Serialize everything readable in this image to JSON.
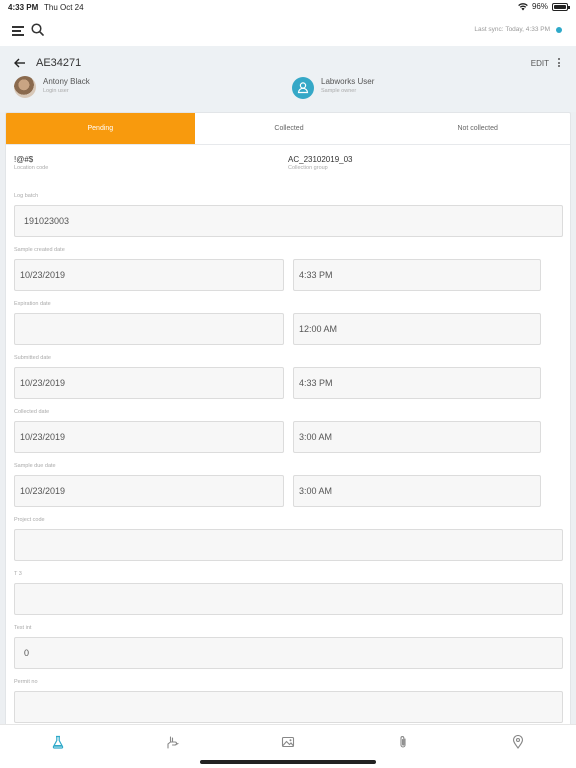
{
  "status_bar": {
    "time": "4:33 PM",
    "date": "Thu Oct 24",
    "battery": "96%"
  },
  "app_bar": {
    "sync_label": "Last sync:",
    "sync_time": "Today, 4:33 PM",
    "sync_dot_color": "#2ea9c9"
  },
  "header": {
    "record_id": "AE34271",
    "edit_label": "EDIT",
    "login_user": {
      "name": "Antony Black",
      "role": "Login user"
    },
    "sample_owner": {
      "name": "Labworks User",
      "role": "Sample owner"
    }
  },
  "tabs": [
    {
      "label": "Pending",
      "active": true
    },
    {
      "label": "Collected",
      "active": false
    },
    {
      "label": "Not collected",
      "active": false
    }
  ],
  "accent_color": "#f89a0d",
  "location": {
    "value": "!@#$",
    "label": "Location code"
  },
  "collection_group": {
    "value": "AC_23102019_03",
    "label": "Collection group"
  },
  "form": {
    "log_batch": {
      "label": "Log batch",
      "value": "191023003"
    },
    "sample_created": {
      "label": "Sample created date",
      "date": "10/23/2019",
      "time": "4:33 PM"
    },
    "expiration": {
      "label": "Expiration date",
      "date": "",
      "time": "12:00 AM"
    },
    "submitted": {
      "label": "Submitted date",
      "date": "10/23/2019",
      "time": "4:33 PM"
    },
    "collected": {
      "label": "Collected date",
      "date": "10/23/2019",
      "time": "3:00 AM"
    },
    "sample_due": {
      "label": "Sample due date",
      "date": "10/23/2019",
      "time": "3:00 AM"
    },
    "project_code": {
      "label": "Project code",
      "value": ""
    },
    "t3": {
      "label": "T 3",
      "value": ""
    },
    "test_int": {
      "label": "Test int",
      "value": "0"
    },
    "permit_no": {
      "label": "Permit no",
      "value": ""
    }
  },
  "bottom_nav": [
    {
      "icon": "flask-icon",
      "active": true
    },
    {
      "icon": "sample-hand-icon",
      "active": false
    },
    {
      "icon": "image-icon",
      "active": false
    },
    {
      "icon": "attachment-icon",
      "active": false
    },
    {
      "icon": "location-pin-icon",
      "active": false
    }
  ]
}
